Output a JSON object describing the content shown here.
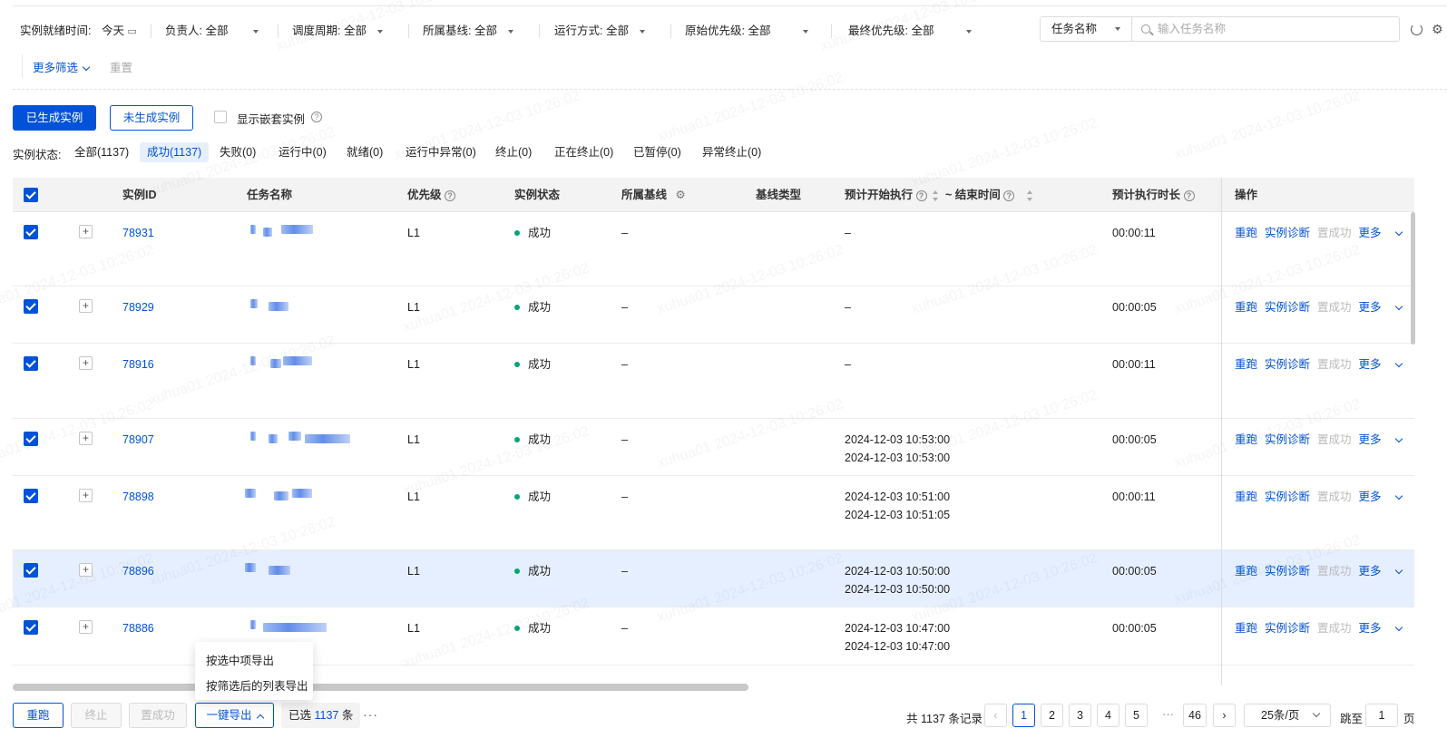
{
  "filters": {
    "ready_time_label": "实例就绪时间:",
    "ready_time_value": "今天",
    "owner": "负责人: 全部",
    "cycle": "调度周期: 全部",
    "baseline": "所属基线: 全部",
    "run_mode": "运行方式: 全部",
    "orig_priority": "原始优先级: 全部",
    "final_priority": "最终优先级: 全部",
    "search_field": "任务名称",
    "search_placeholder": "输入任务名称",
    "more_filter": "更多筛选",
    "reset": "重置"
  },
  "actions": {
    "generated": "已生成实例",
    "not_generated": "未生成实例",
    "show_nested": "显示嵌套实例"
  },
  "status_tabs": {
    "label": "实例状态:",
    "items": [
      "全部(1137)",
      "成功(1137)",
      "失败(0)",
      "运行中(0)",
      "就绪(0)",
      "运行中异常(0)",
      "终止(0)",
      "正在终止(0)",
      "已暂停(0)",
      "异常终止(0)"
    ],
    "active_index": 1
  },
  "table": {
    "headers": {
      "id": "实例ID",
      "name": "任务名称",
      "priority": "优先级",
      "status": "实例状态",
      "baseline": "所属基线",
      "baseline_type": "基线类型",
      "start": "预计开始执行",
      "end": "~ 结束时间",
      "duration": "预计执行时长",
      "ops": "操作"
    },
    "rows": [
      {
        "id": "78931",
        "priority": "L1",
        "status": "成功",
        "baseline": "–",
        "start": "–",
        "end": "",
        "duration": "00:00:11"
      },
      {
        "id": "78929",
        "priority": "L1",
        "status": "成功",
        "baseline": "–",
        "start": "–",
        "end": "",
        "duration": "00:00:05"
      },
      {
        "id": "78916",
        "priority": "L1",
        "status": "成功",
        "baseline": "–",
        "start": "–",
        "end": "",
        "duration": "00:00:11"
      },
      {
        "id": "78907",
        "priority": "L1",
        "status": "成功",
        "baseline": "–",
        "start": "2024-12-03 10:53:00",
        "end": "2024-12-03 10:53:00",
        "duration": "00:00:05"
      },
      {
        "id": "78898",
        "priority": "L1",
        "status": "成功",
        "baseline": "–",
        "start": "2024-12-03 10:51:00",
        "end": "2024-12-03 10:51:05",
        "duration": "00:00:11"
      },
      {
        "id": "78896",
        "priority": "L1",
        "status": "成功",
        "baseline": "–",
        "start": "2024-12-03 10:50:00",
        "end": "2024-12-03 10:50:00",
        "duration": "00:00:05"
      },
      {
        "id": "78886",
        "priority": "L1",
        "status": "成功",
        "baseline": "–",
        "start": "2024-12-03 10:47:00",
        "end": "2024-12-03 10:47:00",
        "duration": "00:00:05"
      }
    ],
    "ops": {
      "rerun": "重跑",
      "diagnose": "实例诊断",
      "set_success": "置成功",
      "more": "更多"
    }
  },
  "export_menu": {
    "selected": "按选中项导出",
    "filtered": "按筛选后的列表导出"
  },
  "footer": {
    "rerun": "重跑",
    "stop": "终止",
    "set_success": "置成功",
    "export": "一键导出",
    "selected_prefix": "已选",
    "selected_count": "1137",
    "selected_suffix": "条",
    "total": "共 1137 条记录",
    "pages": [
      "1",
      "2",
      "3",
      "4",
      "5"
    ],
    "last_page": "46",
    "page_size": "25条/页",
    "jump_label": "跳至",
    "jump_value": "1",
    "jump_suffix": "页"
  },
  "watermark": "xuhua01 2024-12-03 10:26:02"
}
